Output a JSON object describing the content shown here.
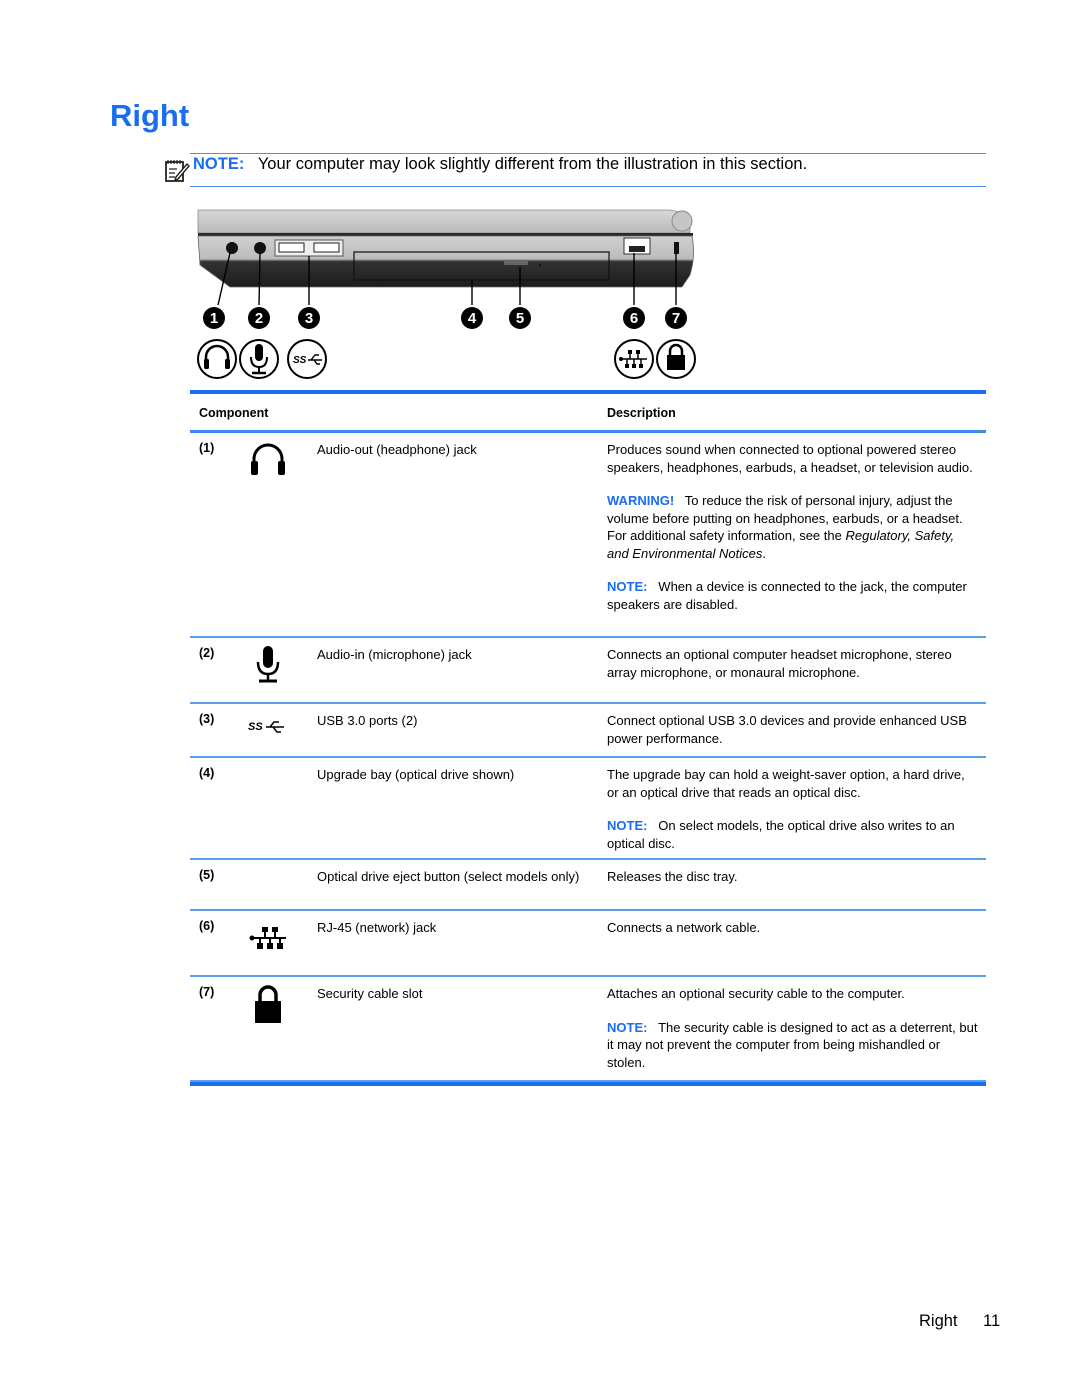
{
  "page": {
    "title": "Right",
    "note": {
      "label": "NOTE:",
      "text": "Your computer may look slightly different from the illustration in this section."
    },
    "illustration": {
      "callouts": [
        "1",
        "2",
        "3",
        "4",
        "5",
        "6",
        "7"
      ],
      "icons": [
        "headphone-icon",
        "microphone-icon",
        "usb-superspeed-icon",
        "network-icon",
        "lock-icon"
      ]
    },
    "table": {
      "headers": {
        "component": "Component",
        "description": "Description"
      },
      "rows": [
        {
          "num": "(1)",
          "icon": "headphone-icon",
          "name": "Audio-out (headphone) jack",
          "desc": "Produces sound when connected to optional powered stereo speakers, headphones, earbuds, a headset, or television audio.",
          "warning": {
            "label": "WARNING!",
            "text": "To reduce the risk of personal injury, adjust the volume before putting on headphones, earbuds, or a headset. For additional safety information, see the",
            "ref": "Regulatory, Safety, and Environmental Notices",
            "end": "."
          },
          "note": {
            "label": "NOTE:",
            "text": "When a device is connected to the jack, the computer speakers are disabled."
          }
        },
        {
          "num": "(2)",
          "icon": "microphone-icon",
          "name": "Audio-in (microphone) jack",
          "desc": "Connects an optional computer headset microphone, stereo array microphone, or monaural microphone."
        },
        {
          "num": "(3)",
          "icon": "usb-superspeed-icon",
          "name": "USB 3.0 ports (2)",
          "desc": "Connect optional USB 3.0 devices and provide enhanced USB power performance."
        },
        {
          "num": "(4)",
          "icon": "",
          "name": "Upgrade bay (optical drive shown)",
          "desc": "The upgrade bay can hold a weight-saver option, a hard drive, or an optical drive that reads an optical disc.",
          "note": {
            "label": "NOTE:",
            "text": "On select models, the optical drive also writes to an optical disc."
          }
        },
        {
          "num": "(5)",
          "icon": "",
          "name": "Optical drive eject button (select models only)",
          "desc": "Releases the disc tray."
        },
        {
          "num": "(6)",
          "icon": "network-icon",
          "name": "RJ-45 (network) jack",
          "desc": "Connects a network cable."
        },
        {
          "num": "(7)",
          "icon": "lock-icon",
          "name": "Security cable slot",
          "desc": "Attaches an optional security cable to the computer.",
          "note": {
            "label": "NOTE:",
            "text": "The security cable is designed to act as a deterrent, but it may not prevent the computer from being mishandled or stolen."
          }
        }
      ]
    },
    "footer": {
      "section": "Right",
      "page_number": "11"
    }
  }
}
